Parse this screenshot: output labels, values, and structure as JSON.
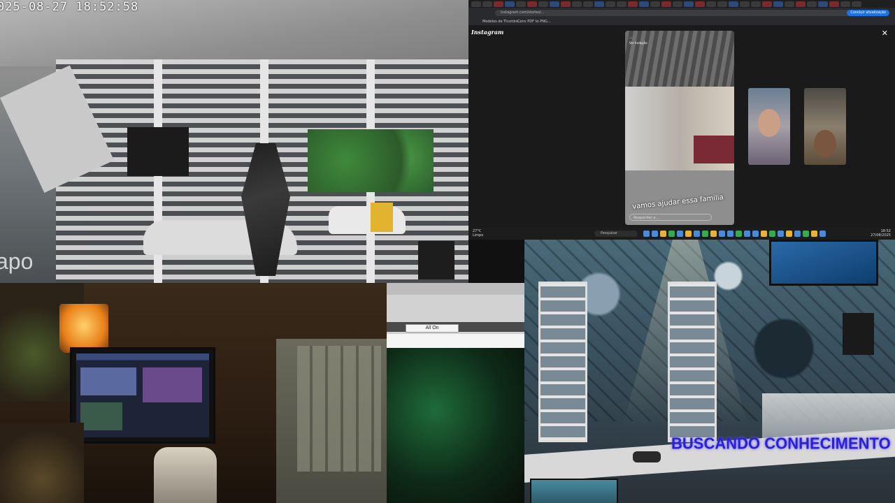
{
  "camera": {
    "timestamp": "025-08-27  18:52:58",
    "watermark": "apo"
  },
  "browser": {
    "url": "instagram.com/stories/...",
    "update_button": "Concluir atualização",
    "bookmarks": [
      "Modelos de Thumbn...",
      "Conv PDF to PNG..."
    ]
  },
  "instagram": {
    "logo": "Instagram",
    "close": "✕",
    "story": {
      "username": "...",
      "sub": "Ver tradução",
      "caption": "vamos ajudar essa familia",
      "reply_placeholder": "Responder a ..."
    }
  },
  "taskbar": {
    "temperature": "27°C",
    "weather": "Limpo",
    "search": "Pesquisar",
    "time": "18:52",
    "date": "27/08/2025"
  },
  "control_panel": {
    "all_on_button": "All On"
  },
  "overlay": {
    "banner": "BUSCANDO CONHECIMENTO"
  },
  "colors": {
    "overlay_text": "#2a20d6",
    "update_button": "#1a73e8",
    "lamp": "#ffcf6a"
  }
}
